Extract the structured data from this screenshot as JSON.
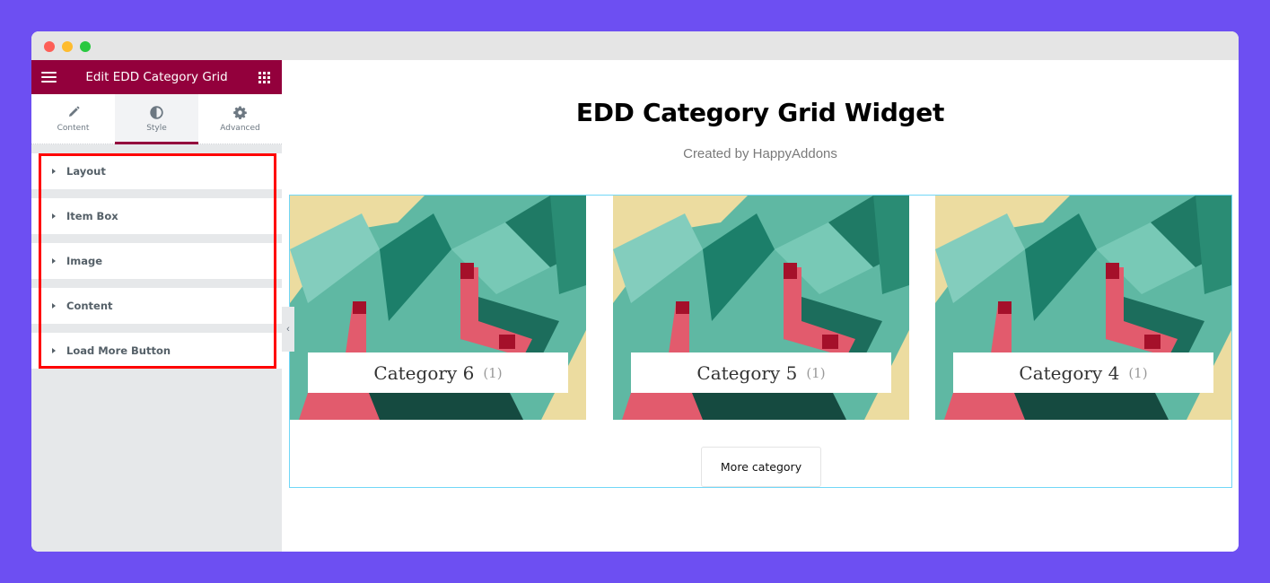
{
  "window": {
    "controls": [
      "close",
      "minimize",
      "maximize"
    ]
  },
  "panel": {
    "title": "Edit EDD Category Grid",
    "menu_icon": "hamburger-icon",
    "widgets_icon": "grid-icon",
    "tabs": [
      {
        "label": "Content",
        "icon": "pencil-icon",
        "active": false
      },
      {
        "label": "Style",
        "icon": "half-circle-icon",
        "active": true
      },
      {
        "label": "Advanced",
        "icon": "gear-icon",
        "active": false
      }
    ],
    "sections": [
      {
        "label": "Layout"
      },
      {
        "label": "Item Box"
      },
      {
        "label": "Image"
      },
      {
        "label": "Content"
      },
      {
        "label": "Load More Button"
      }
    ],
    "highlight_color": "#ff0000",
    "accent_color": "#93003c"
  },
  "preview": {
    "heading": "EDD Category Grid Widget",
    "subtitle": "Created by HappyAddons",
    "categories": [
      {
        "name": "Category 6",
        "count": "(1)"
      },
      {
        "name": "Category 5",
        "count": "(1)"
      },
      {
        "name": "Category 4",
        "count": "(1)"
      }
    ],
    "load_more_label": "More category"
  }
}
